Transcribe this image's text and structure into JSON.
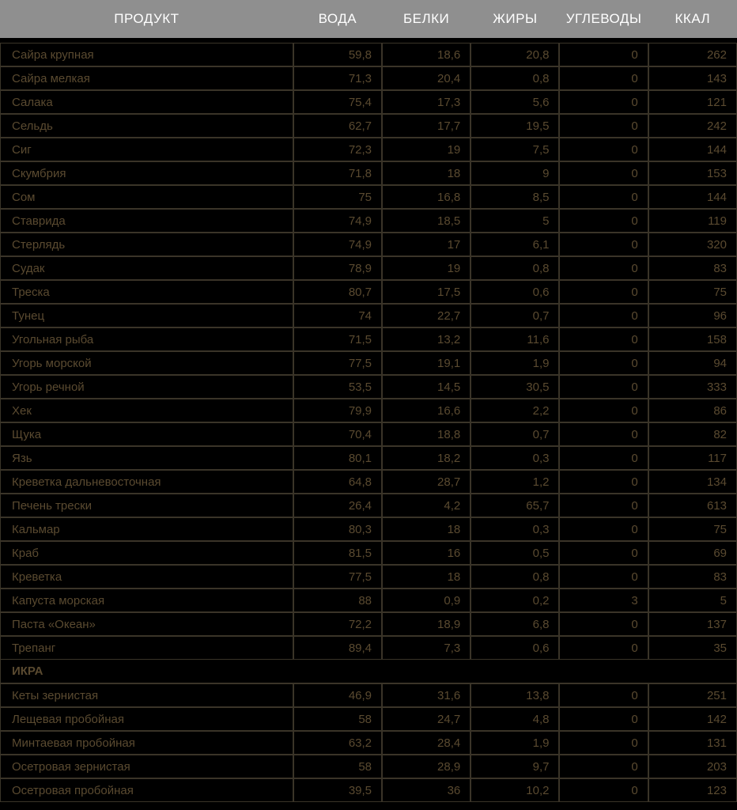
{
  "headers": {
    "product": "ПРОДУКТ",
    "water": "ВОДА",
    "protein": "БЕЛКИ",
    "fat": "ЖИРЫ",
    "carbs": "УГЛЕВОДЫ",
    "kcal": "ККАЛ"
  },
  "rows": [
    {
      "type": "data",
      "product": "Сайра крупная",
      "water": "59,8",
      "protein": "18,6",
      "fat": "20,8",
      "carbs": "0",
      "kcal": "262"
    },
    {
      "type": "data",
      "product": "Сайра мелкая",
      "water": "71,3",
      "protein": "20,4",
      "fat": "0,8",
      "carbs": "0",
      "kcal": "143"
    },
    {
      "type": "data",
      "product": "Салака",
      "water": "75,4",
      "protein": "17,3",
      "fat": "5,6",
      "carbs": "0",
      "kcal": "121"
    },
    {
      "type": "data",
      "product": "Сельдь",
      "water": "62,7",
      "protein": "17,7",
      "fat": "19,5",
      "carbs": "0",
      "kcal": "242"
    },
    {
      "type": "data",
      "product": "Сиг",
      "water": "72,3",
      "protein": "19",
      "fat": "7,5",
      "carbs": "0",
      "kcal": "144"
    },
    {
      "type": "data",
      "product": "Скумбрия",
      "water": "71,8",
      "protein": "18",
      "fat": "9",
      "carbs": "0",
      "kcal": "153"
    },
    {
      "type": "data",
      "product": "Сом",
      "water": "75",
      "protein": "16,8",
      "fat": "8,5",
      "carbs": "0",
      "kcal": "144"
    },
    {
      "type": "data",
      "product": "Ставрида",
      "water": "74,9",
      "protein": "18,5",
      "fat": "5",
      "carbs": "0",
      "kcal": "119"
    },
    {
      "type": "data",
      "product": "Стерлядь",
      "water": "74,9",
      "protein": "17",
      "fat": "6,1",
      "carbs": "0",
      "kcal": "320"
    },
    {
      "type": "data",
      "product": "Судак",
      "water": "78,9",
      "protein": "19",
      "fat": "0,8",
      "carbs": "0",
      "kcal": "83"
    },
    {
      "type": "data",
      "product": "Треска",
      "water": "80,7",
      "protein": "17,5",
      "fat": "0,6",
      "carbs": "0",
      "kcal": "75"
    },
    {
      "type": "data",
      "product": "Тунец",
      "water": "74",
      "protein": "22,7",
      "fat": "0,7",
      "carbs": "0",
      "kcal": "96"
    },
    {
      "type": "data",
      "product": "Угольная рыба",
      "water": "71,5",
      "protein": "13,2",
      "fat": "11,6",
      "carbs": "0",
      "kcal": "158"
    },
    {
      "type": "data",
      "product": "Угорь морской",
      "water": "77,5",
      "protein": "19,1",
      "fat": "1,9",
      "carbs": "0",
      "kcal": "94"
    },
    {
      "type": "data",
      "product": "Угорь речной",
      "water": "53,5",
      "protein": "14,5",
      "fat": "30,5",
      "carbs": "0",
      "kcal": "333"
    },
    {
      "type": "data",
      "product": "Хек",
      "water": "79,9",
      "protein": "16,6",
      "fat": "2,2",
      "carbs": "0",
      "kcal": "86"
    },
    {
      "type": "data",
      "product": "Щука",
      "water": "70,4",
      "protein": "18,8",
      "fat": "0,7",
      "carbs": "0",
      "kcal": "82"
    },
    {
      "type": "data",
      "product": "Язь",
      "water": "80,1",
      "protein": "18,2",
      "fat": "0,3",
      "carbs": "0",
      "kcal": "117"
    },
    {
      "type": "data",
      "product": "Креветка дальневосточная",
      "water": "64,8",
      "protein": "28,7",
      "fat": "1,2",
      "carbs": "0",
      "kcal": "134"
    },
    {
      "type": "data",
      "product": "Печень трески",
      "water": "26,4",
      "protein": "4,2",
      "fat": "65,7",
      "carbs": "0",
      "kcal": "613"
    },
    {
      "type": "data",
      "product": "Кальмар",
      "water": "80,3",
      "protein": "18",
      "fat": "0,3",
      "carbs": "0",
      "kcal": "75"
    },
    {
      "type": "data",
      "product": "Краб",
      "water": "81,5",
      "protein": "16",
      "fat": "0,5",
      "carbs": "0",
      "kcal": "69"
    },
    {
      "type": "data",
      "product": "Креветка",
      "water": "77,5",
      "protein": "18",
      "fat": "0,8",
      "carbs": "0",
      "kcal": "83"
    },
    {
      "type": "data",
      "product": "Капуста морская",
      "water": "88",
      "protein": "0,9",
      "fat": "0,2",
      "carbs": "3",
      "kcal": "5"
    },
    {
      "type": "data",
      "product": "Паста «Океан»",
      "water": "72,2",
      "protein": "18,9",
      "fat": "6,8",
      "carbs": "0",
      "kcal": "137"
    },
    {
      "type": "data",
      "product": "Трепанг",
      "water": "89,4",
      "protein": "7,3",
      "fat": "0,6",
      "carbs": "0",
      "kcal": "35"
    },
    {
      "type": "section",
      "product": "ИКРА"
    },
    {
      "type": "data",
      "product": "Кеты зернистая",
      "water": "46,9",
      "protein": "31,6",
      "fat": "13,8",
      "carbs": "0",
      "kcal": "251"
    },
    {
      "type": "data",
      "product": "Лещевая пробойная",
      "water": "58",
      "protein": "24,7",
      "fat": "4,8",
      "carbs": "0",
      "kcal": "142"
    },
    {
      "type": "data",
      "product": "Минтаевая пробойная",
      "water": "63,2",
      "protein": "28,4",
      "fat": "1,9",
      "carbs": "0",
      "kcal": "131"
    },
    {
      "type": "data",
      "product": "Осетровая зернистая",
      "water": "58",
      "protein": "28,9",
      "fat": "9,7",
      "carbs": "0",
      "kcal": "203"
    },
    {
      "type": "data",
      "product": "Осетровая пробойная",
      "water": "39,5",
      "protein": "36",
      "fat": "10,2",
      "carbs": "0",
      "kcal": "123"
    }
  ]
}
